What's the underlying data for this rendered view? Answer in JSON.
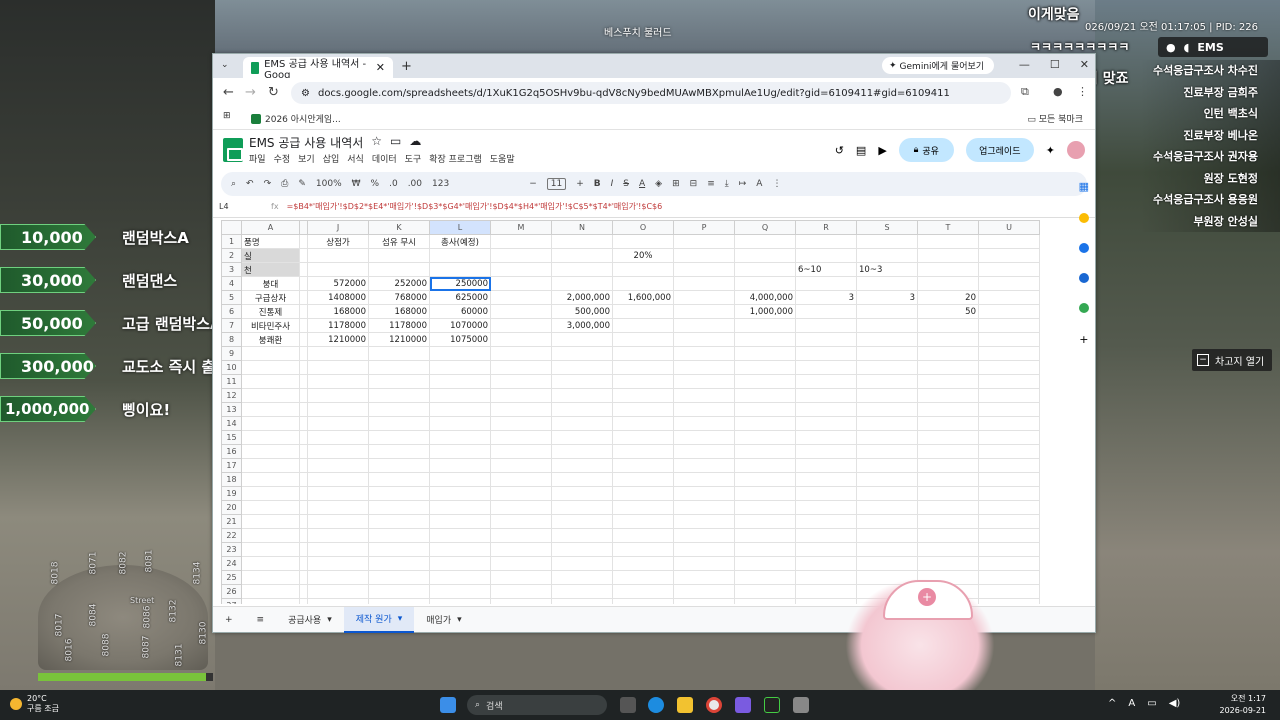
{
  "game": {
    "street_label": "베스푸치 불러드",
    "timestamp": "026/09/21 오전 01:17:05 | PID: 226",
    "chat_top": "이게맞음",
    "chat_laugh": "ㅋㅋㅋㅋㅋㅋㅋㅋㅋ",
    "chat_money": "100만원이 맞죠",
    "ems_label": "EMS",
    "memo_button": "차고지 열기",
    "price_list": [
      {
        "price": "10,000",
        "label": "랜덤박스A"
      },
      {
        "price": "30,000",
        "label": "랜덤댄스"
      },
      {
        "price": "50,000",
        "label": "고급 랜덤박스A"
      },
      {
        "price": "300,000",
        "label": "교도소 즉시 출소"
      },
      {
        "price": "1,000,000",
        "label": "삥이요!"
      }
    ],
    "staff_list": [
      "수석응급구조사 차수진",
      "진료부장 금희주",
      "인턴 백초식",
      "진료부장 베나온",
      "수석응급구조사 권자용",
      "원장 도현정",
      "수석응급구조사 용응원",
      "부원장 안성실"
    ],
    "minimap_numbers": [
      "8018",
      "8071",
      "8082",
      "8081",
      "8134",
      "8017",
      "8084",
      "8086",
      "8132",
      "8016",
      "8088",
      "8087",
      "8131",
      "8130"
    ],
    "minimap_street": "Street",
    "health_fraction": 0.96
  },
  "browser": {
    "tab_title": "EMS 공급 사용 내역서 - Goog",
    "gemini_chip": "Gemini에게 물어보기",
    "url": "docs.google.com/spreadsheets/d/1XuK1G2q5OSHv9bu-qdV8cNy9bedMUAwMBXpmulAe1Ug/edit?gid=6109411#gid=6109411",
    "bookmark": "2026 아시안게임...",
    "bookmarks_folder": "모든 북마크"
  },
  "sheet": {
    "title": "EMS 공급 사용 내역서",
    "menus": [
      "파일",
      "수정",
      "보기",
      "삽입",
      "서식",
      "데이터",
      "도구",
      "확장 프로그램",
      "도움말"
    ],
    "share": "공유",
    "upgrade": "업그레이드",
    "toolbar": {
      "zoom": "100%",
      "font_size": "11",
      "currency": "₩",
      "percent": "%",
      "decimal_minus": ".0",
      "decimal_plus": ".00",
      "number_fmt": "123"
    },
    "cell_ref": "L4",
    "formula": "=$B4*'매입가'!$D$2*$E4*'매입가'!$D$3*$G4*'매입가'!$D$4*$H4*'매입가'!$C$5*$T4*'매입가'!$C$6",
    "columns": [
      "A",
      "",
      "J",
      "K",
      "L",
      "M",
      "N",
      "O",
      "P",
      "Q",
      "R",
      "S",
      "T",
      "U"
    ],
    "rows": [
      {
        "n": "1",
        "A": "품명",
        "J": "상점가",
        "K": "섬유 무시",
        "L": "총사(예정)",
        "M": "",
        "N": "",
        "O": "",
        "P": "",
        "Q": "",
        "R": "",
        "S": "",
        "T": "",
        "U": ""
      },
      {
        "n": "2",
        "A": "실",
        "J": "",
        "K": "",
        "L": "",
        "M": "",
        "N": "",
        "O": "20%",
        "P": "",
        "Q": "",
        "R": "",
        "S": "",
        "T": "",
        "U": ""
      },
      {
        "n": "3",
        "A": "천",
        "J": "",
        "K": "",
        "L": "",
        "M": "",
        "N": "",
        "O": "",
        "P": "",
        "Q": "",
        "R": "6~10",
        "S": "10~3",
        "T": "",
        "U": ""
      },
      {
        "n": "4",
        "A": "붕대",
        "J": "572000",
        "K": "252000",
        "L": "250000",
        "M": "",
        "N": "",
        "O": "",
        "P": "",
        "Q": "",
        "R": "",
        "S": "",
        "T": "",
        "U": ""
      },
      {
        "n": "5",
        "A": "구급상자",
        "J": "1408000",
        "K": "768000",
        "L": "625000",
        "M": "",
        "N": "2,000,000",
        "O": "1,600,000",
        "P": "",
        "Q": "4,000,000",
        "R": "3",
        "S": "3",
        "T": "20",
        "U": ""
      },
      {
        "n": "6",
        "A": "진통제",
        "J": "168000",
        "K": "168000",
        "L": "60000",
        "M": "",
        "N": "500,000",
        "O": "",
        "P": "",
        "Q": "1,000,000",
        "R": "",
        "S": "",
        "T": "50",
        "U": ""
      },
      {
        "n": "7",
        "A": "비타민주사",
        "J": "1178000",
        "K": "1178000",
        "L": "1070000",
        "M": "",
        "N": "3,000,000",
        "O": "",
        "P": "",
        "Q": "",
        "R": "",
        "S": "",
        "T": "",
        "U": ""
      },
      {
        "n": "8",
        "A": "붕쾌환",
        "J": "1210000",
        "K": "1210000",
        "L": "1075000",
        "M": "",
        "N": "",
        "O": "",
        "P": "",
        "Q": "",
        "R": "",
        "S": "",
        "T": "",
        "U": ""
      }
    ],
    "empty_rows": [
      "9",
      "10",
      "11",
      "12",
      "13",
      "14",
      "15",
      "16",
      "17",
      "18",
      "19",
      "20",
      "21",
      "22",
      "23",
      "24",
      "25",
      "26",
      "27",
      "28"
    ],
    "sheet_tabs": [
      "공급사용",
      "제작 원가",
      "매입가"
    ],
    "active_tab": "제작 원가"
  },
  "taskbar": {
    "temp": "20°C",
    "weather": "구름 조금",
    "search": "검색",
    "time": "오전 1:17",
    "date": "2026-09-21"
  }
}
